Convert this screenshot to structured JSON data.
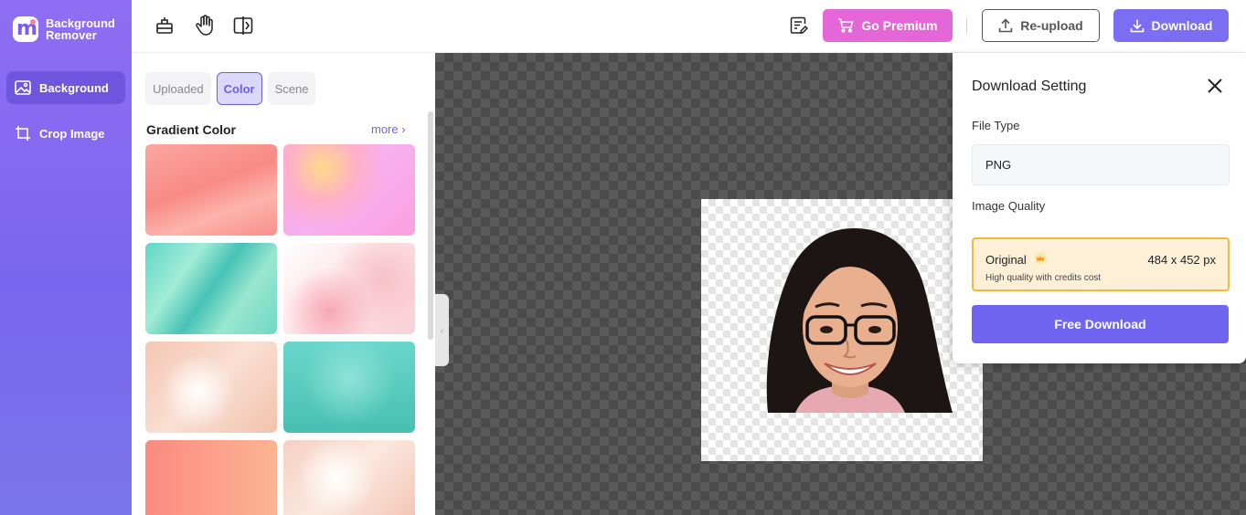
{
  "app": {
    "logo_text": "Background Remover",
    "logo_glyph": "m"
  },
  "sidebar": {
    "items": [
      {
        "label": "Background",
        "icon": "image-icon",
        "active": true
      },
      {
        "label": "Crop Image",
        "icon": "crop-icon",
        "active": false
      }
    ]
  },
  "toolbar": {
    "tools": [
      "eraser-icon",
      "hand-icon",
      "compare-icon"
    ],
    "notes_icon": "notes-edit-icon",
    "premium_label": "Go Premium",
    "reupload_label": "Re-upload",
    "download_label": "Download"
  },
  "panel": {
    "tabs": [
      {
        "label": "Uploaded",
        "active": false
      },
      {
        "label": "Color",
        "active": true
      },
      {
        "label": "Scene",
        "active": false
      }
    ],
    "section_title": "Gradient Color",
    "more_label": "more ›"
  },
  "download_setting": {
    "title": "Download Setting",
    "file_type_label": "File Type",
    "file_type_value": "PNG",
    "image_quality_label": "Image Quality",
    "quality_option": {
      "name": "Original",
      "size": "484 x 452 px",
      "description": "High quality with credits cost"
    },
    "free_download_label": "Free Download"
  },
  "colors": {
    "brand": "#7b6ef2",
    "premium": "#e566d6",
    "quality_border": "#f3b93a"
  }
}
